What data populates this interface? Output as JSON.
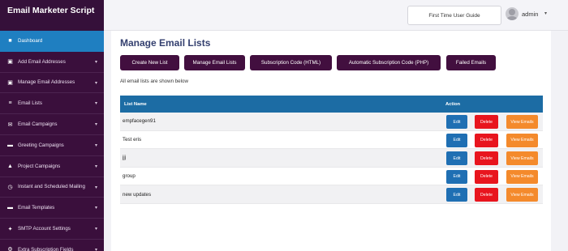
{
  "brand": "Email Marketer Script",
  "sidebar": {
    "items": [
      {
        "label": "Dashboard",
        "icon": "dashboard-icon",
        "glyph": "■",
        "active": true,
        "has_chevron": false
      },
      {
        "label": "Add Email Addresses",
        "icon": "add-address-icon",
        "glyph": "▣",
        "has_chevron": true
      },
      {
        "label": "Manage Email Addresses",
        "icon": "manage-address-icon",
        "glyph": "▣",
        "has_chevron": true
      },
      {
        "label": "Email Lists",
        "icon": "list-icon",
        "glyph": "≡",
        "has_chevron": true
      },
      {
        "label": "Email Campaigns",
        "icon": "envelope-icon",
        "glyph": "✉",
        "has_chevron": true
      },
      {
        "label": "Greeting Campaigns",
        "icon": "greeting-icon",
        "glyph": "▬",
        "has_chevron": true
      },
      {
        "label": "Project Campaigns",
        "icon": "project-icon",
        "glyph": "▲",
        "has_chevron": true
      },
      {
        "label": "Instant and Scheduled Mailing",
        "icon": "clock-icon",
        "glyph": "◷",
        "has_chevron": true
      },
      {
        "label": "Email Templates",
        "icon": "template-icon",
        "glyph": "▬",
        "has_chevron": true
      },
      {
        "label": "SMTP Account Settings",
        "icon": "wrench-icon",
        "glyph": "✦",
        "has_chevron": true
      },
      {
        "label": "Extra Subscription Fields",
        "icon": "gear-icon",
        "glyph": "⚙",
        "has_chevron": true
      }
    ],
    "chevron": "▾"
  },
  "topbar": {
    "guide_label": "First Time User Guide",
    "user": "admin",
    "caret": "▾"
  },
  "main": {
    "title": "Manage Email Lists",
    "tabs": [
      {
        "label": "Create New List"
      },
      {
        "label": "Manage Email Lists"
      },
      {
        "label": "Subscription Code (HTML)"
      },
      {
        "label": "Automatic Subscription Code (PHP)"
      },
      {
        "label": "Failed Emails"
      }
    ],
    "subtitle": "All email lists are shown below",
    "table": {
      "headers": [
        "List Name",
        "Action"
      ],
      "rows": [
        {
          "name": "empfacegen91"
        },
        {
          "name": "Test eris"
        },
        {
          "name": "jjj"
        },
        {
          "name": "group"
        },
        {
          "name": "new updates"
        }
      ],
      "actions": {
        "edit": "Edit",
        "delete": "Delete",
        "view": "View Emails"
      }
    }
  },
  "colors": {
    "sidebar_bg": "#3a0f3c",
    "sidebar_active": "#1f7fc1",
    "tab_bg": "#420f3f",
    "table_header": "#1c6ca4",
    "edit": "#1f6fb3",
    "delete": "#e8151e",
    "view": "#f48a2c"
  }
}
